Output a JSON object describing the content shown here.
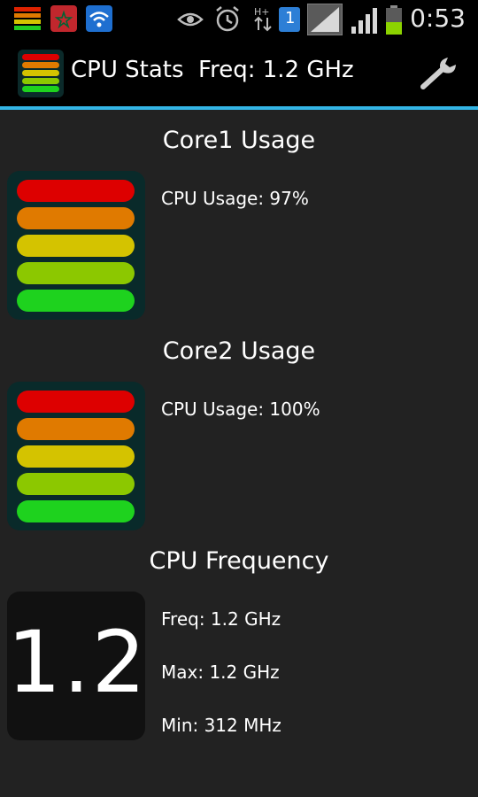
{
  "status_bar": {
    "time": "0:53",
    "sim_badge": "1",
    "icons": [
      "app-meter-icon",
      "flag-icon",
      "wifi-icon",
      "eye-icon",
      "alarm-icon",
      "data-transfer-icon",
      "sim-icon",
      "signal-icon",
      "signal-icon-2",
      "battery-icon"
    ]
  },
  "action_bar": {
    "title": "CPU Stats  Freq: 1.2 GHz",
    "settings_icon": "wrench-icon",
    "accent_color": "#33b5e5"
  },
  "core1": {
    "title": "Core1 Usage",
    "usage_label": "CPU Usage: 97%",
    "usage_percent": 97
  },
  "core2": {
    "title": "Core2 Usage",
    "usage_label": "CPU Usage: 100%",
    "usage_percent": 100
  },
  "frequency": {
    "title": "CPU Frequency",
    "big_value": "1.2",
    "freq": "Freq: 1.2 GHz",
    "max": "Max: 1.2 GHz",
    "min": "Min: 312 MHz"
  },
  "meter_colors": [
    "#dd0000",
    "#e07a00",
    "#d4c300",
    "#8cc800",
    "#1ed21e"
  ]
}
